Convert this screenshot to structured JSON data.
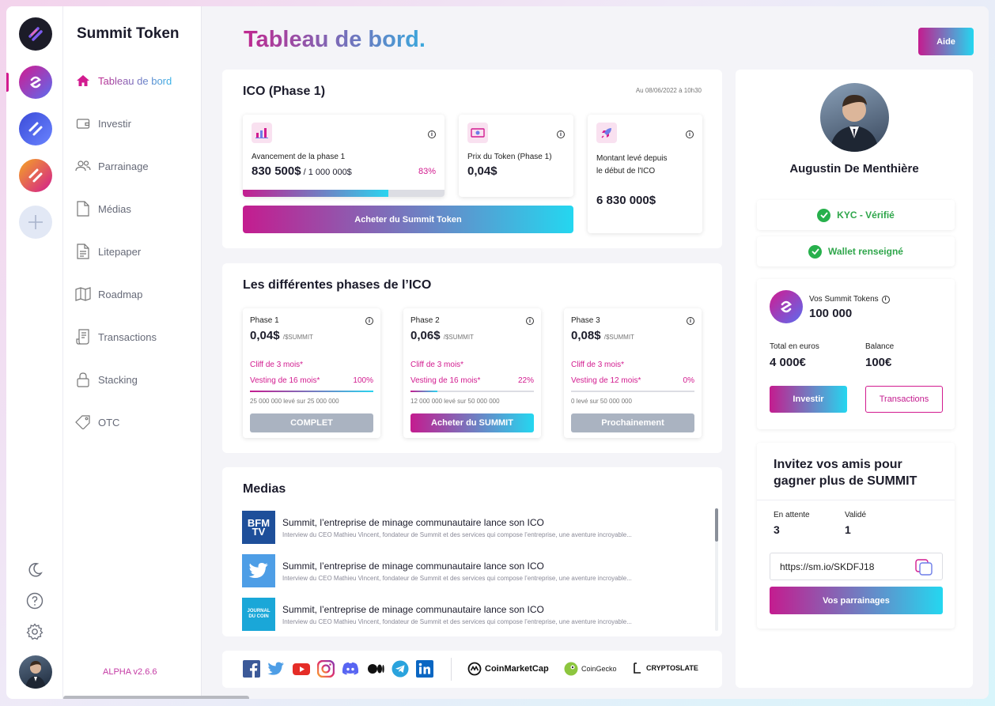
{
  "app": {
    "brand": "Summit Token",
    "version": "ALPHA v2.6.6"
  },
  "nav": [
    {
      "label": "Tableau de bord",
      "icon": "home-icon",
      "active": true
    },
    {
      "label": "Investir",
      "icon": "wallet-icon"
    },
    {
      "label": "Parrainage",
      "icon": "users-icon"
    },
    {
      "label": "Médias",
      "icon": "document-icon"
    },
    {
      "label": "Litepaper",
      "icon": "paper-icon"
    },
    {
      "label": "Roadmap",
      "icon": "map-icon"
    },
    {
      "label": "Transactions",
      "icon": "receipt-icon"
    },
    {
      "label": "Stacking",
      "icon": "lock-icon"
    },
    {
      "label": "OTC",
      "icon": "tag-icon"
    }
  ],
  "header": {
    "title_part1": "Tableau",
    "title_part2": " de bord.",
    "help": "Aide"
  },
  "ico": {
    "title": "ICO (Phase 1)",
    "date": "Au 08/06/2022 à 10h30",
    "progress_label": "Avancement de la phase 1",
    "progress_value": "830 500$",
    "progress_total": " / 1 000 000$",
    "progress_percent": "83%",
    "progress_fraction": 0.72,
    "price_label": "Prix du Token (Phase 1)",
    "price_value": "0,04$",
    "raised_label_1": "Montant levé depuis",
    "raised_label_2": "le début de l'ICO",
    "raised_value": "6 830 000$",
    "buy_button": "Acheter du Summit Token"
  },
  "phases": {
    "title": "Les différentes phases de l’ICO",
    "items": [
      {
        "name": "Phase 1",
        "price": "0,04$",
        "unit": "/$SUMMIT",
        "cliff": "Cliff de 3 mois*",
        "vesting": "Vesting de 16 mois*",
        "percent": "100%",
        "fill": 1.0,
        "raised": "25 000 000 levé sur 25 000 000",
        "button": "COMPLET",
        "style": "grey"
      },
      {
        "name": "Phase 2",
        "price": "0,06$",
        "unit": "/$SUMMIT",
        "cliff": "Cliff de 3 mois*",
        "vesting": "Vesting de 16 mois*",
        "percent": "22%",
        "fill": 0.22,
        "raised": "12 000 000 levé sur 50 000 000",
        "button": "Acheter du SUMMIT",
        "style": "grad"
      },
      {
        "name": "Phase 3",
        "price": "0,08$",
        "unit": "/$SUMMIT",
        "cliff": "Cliff de 3 mois*",
        "vesting": "Vesting de 12 mois*",
        "percent": "0%",
        "fill": 0.0,
        "raised": "0 levé sur 50 000 000",
        "button": "Prochainement",
        "style": "grey"
      }
    ]
  },
  "medias": {
    "title": "Medias",
    "items": [
      {
        "logo": "BFM TV",
        "color": "#1e4f9a",
        "title": "Summit, l’entreprise de minage communautaire lance son ICO",
        "sub": "Interview du CEO Mathieu Vincent, fondateur de Summit et des services qui compose l’entreprise, une aventure incroyable..."
      },
      {
        "logo": "twitter",
        "color": "#4e9ee6",
        "title": "Summit, l’entreprise de minage communautaire lance son ICO",
        "sub": "Interview du CEO Mathieu Vincent, fondateur de Summit et des services qui compose l’entreprise, une aventure incroyable..."
      },
      {
        "logo": "JOURNAL DU COIN",
        "color": "#1aa7d8",
        "title": "Summit, l’entreprise de minage communautaire lance son ICO",
        "sub": "Interview du CEO Mathieu Vincent, fondateur de Summit et des services qui compose l’entreprise, une aventure incroyable..."
      }
    ]
  },
  "partners": [
    "CoinMarketCap",
    "CoinGecko",
    "CRYPTOSLATE"
  ],
  "profile": {
    "name": "Augustin De Menthière",
    "kyc": "KYC - Vérifié",
    "wallet": "Wallet renseigné",
    "tokens_label": "Vos Summit Tokens",
    "tokens_value": "100 000",
    "total_label": "Total en euros",
    "total_value": "4 000€",
    "balance_label": "Balance",
    "balance_value": "100€",
    "invest_button": "Investir",
    "transactions_button": "Transactions"
  },
  "referral": {
    "title_1": "Invitez vos amis pour",
    "title_2": "gagner plus de SUMMIT",
    "pending_label": "En attente",
    "pending_value": "3",
    "valid_label": "Validé",
    "valid_value": "1",
    "link": "https://sm.io/SKDFJ18",
    "button": "Vos parrainages"
  }
}
